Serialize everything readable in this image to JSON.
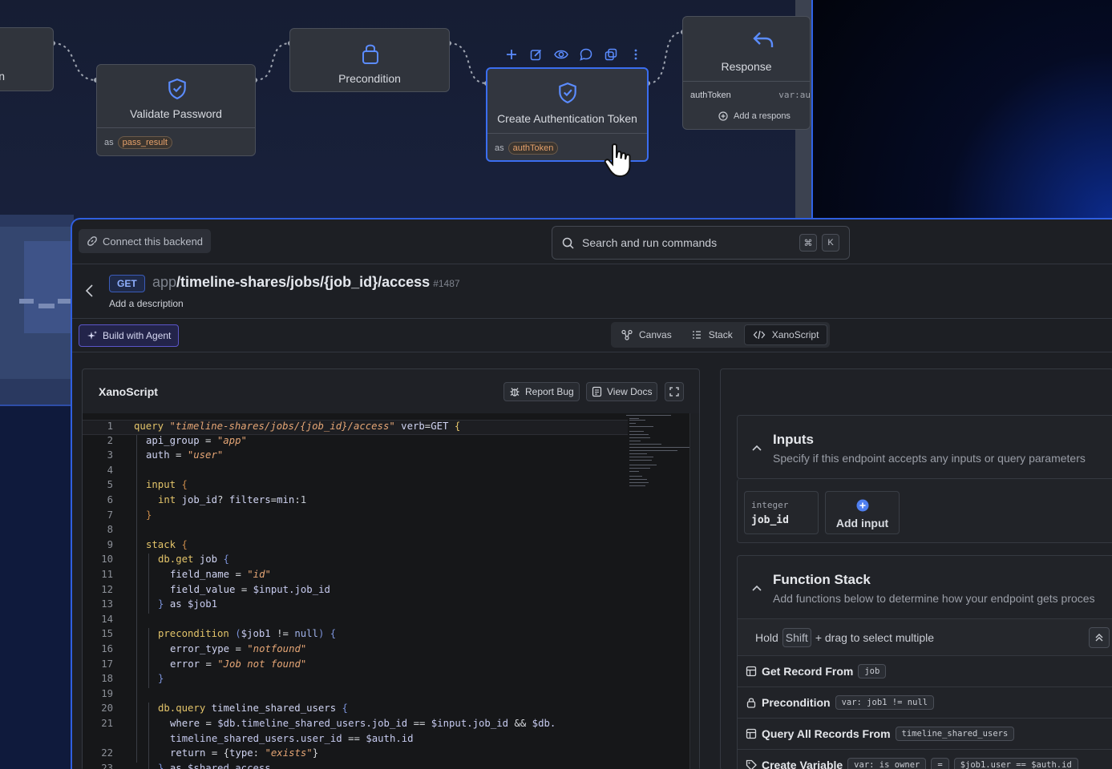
{
  "flow": {
    "node_partial_label": "n",
    "validate": {
      "title": "Validate Password",
      "as_label": "as",
      "var": "pass_result"
    },
    "precondition": {
      "title": "Precondition"
    },
    "create_token": {
      "title": "Create Authentication Token",
      "as_label": "as",
      "var": "authToken"
    },
    "response": {
      "title": "Response",
      "field_name": "authToken",
      "field_value": "var:au",
      "add_label": "Add a respons"
    }
  },
  "topbar": {
    "connect_label": "Connect this backend",
    "search_placeholder": "Search and run commands",
    "kbd_cmd": "⌘",
    "kbd_k": "K"
  },
  "endpoint": {
    "verb": "GET",
    "group": "app",
    "path": "/timeline-shares/jobs/{job_id}/access",
    "id": "#1487",
    "description": "Add a description"
  },
  "subbar": {
    "agent_label": "Build with Agent",
    "tabs": [
      {
        "label": "Canvas"
      },
      {
        "label": "Stack"
      },
      {
        "label": "XanoScript"
      }
    ]
  },
  "editor": {
    "title": "XanoScript",
    "report_bug": "Report Bug",
    "view_docs": "View Docs",
    "line_numbers": [
      "1",
      "2",
      "3",
      "4",
      "5",
      "6",
      "7",
      "8",
      "9",
      "10",
      "11",
      "12",
      "13",
      "14",
      "15",
      "16",
      "17",
      "18",
      "19",
      "20",
      "21",
      "",
      "22",
      "23"
    ]
  },
  "inputs": {
    "title": "Inputs",
    "subtitle": "Specify if this endpoint accepts any inputs or query parameters",
    "item_type": "integer",
    "item_name": "job_id",
    "add_label": "Add input"
  },
  "function_stack": {
    "title": "Function Stack",
    "subtitle": "Add functions below to determine how your endpoint gets proces",
    "hint_hold": "Hold",
    "hint_key": "Shift",
    "hint_rest": "+ drag to select multiple",
    "items": [
      {
        "name": "Get Record From",
        "pills": [
          "job"
        ],
        "icon": "table-icon"
      },
      {
        "name": "Precondition",
        "pills": [
          "var: job1 != null"
        ],
        "icon": "lock-icon"
      },
      {
        "name": "Query All Records From",
        "pills": [
          "timeline_shared_users"
        ],
        "icon": "table-icon"
      },
      {
        "name": "Create Variable",
        "pills": [
          "var: is_owner",
          "=",
          "$job1.user == $auth.id"
        ],
        "icon": "tag-icon"
      }
    ]
  },
  "colors": {
    "accent": "#2f5fe0",
    "keyword": "#e3c46a",
    "string": "#e4a575",
    "badge": "#8fb0ff"
  }
}
